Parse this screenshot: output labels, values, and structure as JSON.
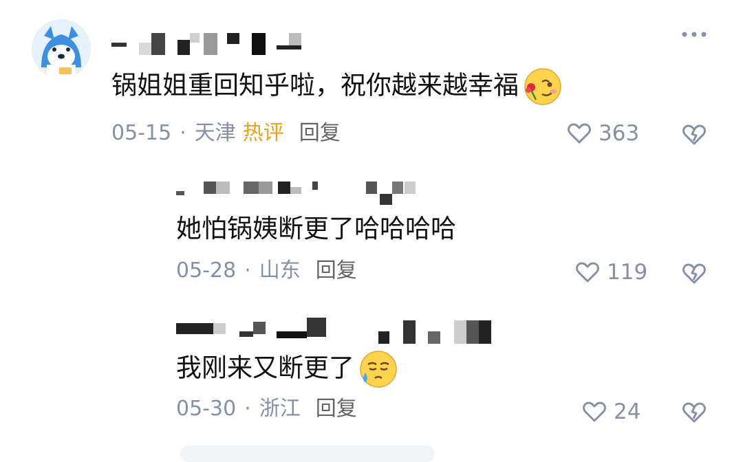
{
  "comments": [
    {
      "text": "锅姐姐重回知乎啦，祝你越来越幸福",
      "date": "05-15",
      "location": "天津",
      "badge": "热评",
      "reply_label": "回复",
      "likes": "363",
      "emoji": "rose-emoji"
    },
    {
      "text": "她怕锅姨断更了哈哈哈哈",
      "date": "05-28",
      "location": "山东",
      "reply_label": "回复",
      "likes": "119"
    },
    {
      "text": "我刚来又断更了",
      "date": "05-30",
      "location": "浙江",
      "reply_label": "回复",
      "likes": "24",
      "emoji": "crying-emoji"
    }
  ],
  "meta_separator": "·",
  "colors": {
    "text": "#121212",
    "meta": "#8590a6",
    "hot_badge": "#e8a317",
    "avatar_bg": "#e6f1fb"
  },
  "icons": [
    "more-icon",
    "heart-icon",
    "dislike-icon"
  ]
}
